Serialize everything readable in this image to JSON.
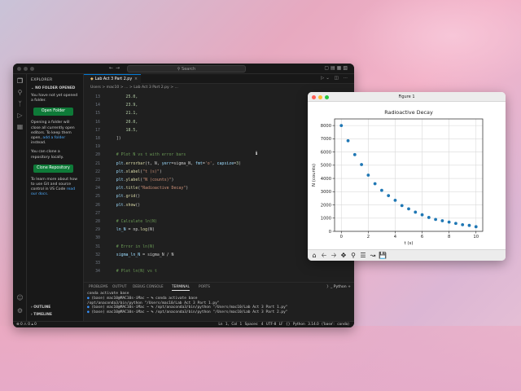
{
  "colors": {
    "green_button": "#0e7a38",
    "accent": "#0078d4",
    "link": "#4daafc",
    "plot_point": "#1f77b4"
  },
  "vscode": {
    "search_text": "Search",
    "tab_title": "Lab Act 3 Part 2.py",
    "breadcrumb": "Users > mac10 > ... > Lab Act 3 Part 2.py > ...",
    "explorer": {
      "title": "EXPLORER",
      "section": "NO FOLDER OPENED",
      "msg1": "You have not yet opened a folder.",
      "open_folder_label": "Open Folder",
      "msg2_pre": "Opening a folder will close all currently open editors. To keep them open,",
      "msg2_link": "add a folder",
      "msg2_post": "instead.",
      "msg3": "You can clone a repository locally.",
      "clone_label": "Clone Repository",
      "msg4_pre": "To learn more about how to use Git and source control in VS Code",
      "msg4_link": "read our docs.",
      "outline": "OUTLINE",
      "timeline": "TIMELINE"
    },
    "code_lines": [
      {
        "n": "13",
        "parts": [
          [
            "c-num",
            "        25.0,"
          ]
        ]
      },
      {
        "n": "14",
        "parts": [
          [
            "c-num",
            "        23.9,"
          ]
        ]
      },
      {
        "n": "15",
        "parts": [
          [
            "c-num",
            "        21.1,"
          ]
        ]
      },
      {
        "n": "16",
        "parts": [
          [
            "c-num",
            "        20.0,"
          ]
        ]
      },
      {
        "n": "17",
        "parts": [
          [
            "c-num",
            "        18.5,"
          ]
        ]
      },
      {
        "n": "18",
        "parts": [
          [
            "c-def",
            "    ])"
          ]
        ]
      },
      {
        "n": "19",
        "parts": []
      },
      {
        "n": "20",
        "parts": [
          [
            "c-com",
            "    # Plot N vs t with error bars"
          ]
        ]
      },
      {
        "n": "21",
        "parts": [
          [
            "c-var",
            "    plt"
          ],
          [
            "c-def",
            "."
          ],
          [
            "c-fn",
            "errorbar"
          ],
          [
            "c-def",
            "(t, N, "
          ],
          [
            "c-var",
            "yerr"
          ],
          [
            "c-def",
            "=sigma_N, "
          ],
          [
            "c-var",
            "fmt"
          ],
          [
            "c-def",
            "="
          ],
          [
            "c-str",
            "'o'"
          ],
          [
            "c-def",
            ", "
          ],
          [
            "c-var",
            "capsize"
          ],
          [
            "c-def",
            "="
          ],
          [
            "c-num",
            "3"
          ],
          [
            "c-def",
            ")"
          ]
        ]
      },
      {
        "n": "22",
        "parts": [
          [
            "c-var",
            "    plt"
          ],
          [
            "c-def",
            "."
          ],
          [
            "c-fn",
            "xlabel"
          ],
          [
            "c-def",
            "("
          ],
          [
            "c-str",
            "\"t (s)\""
          ],
          [
            "c-def",
            ")"
          ]
        ]
      },
      {
        "n": "23",
        "parts": [
          [
            "c-var",
            "    plt"
          ],
          [
            "c-def",
            "."
          ],
          [
            "c-fn",
            "ylabel"
          ],
          [
            "c-def",
            "("
          ],
          [
            "c-str",
            "\"N (counts)\""
          ],
          [
            "c-def",
            ")"
          ]
        ]
      },
      {
        "n": "24",
        "parts": [
          [
            "c-var",
            "    plt"
          ],
          [
            "c-def",
            "."
          ],
          [
            "c-fn",
            "title"
          ],
          [
            "c-def",
            "("
          ],
          [
            "c-str",
            "\"Radioactive Decay\""
          ],
          [
            "c-def",
            ")"
          ]
        ]
      },
      {
        "n": "25",
        "parts": [
          [
            "c-var",
            "    plt"
          ],
          [
            "c-def",
            "."
          ],
          [
            "c-fn",
            "grid"
          ],
          [
            "c-def",
            "()"
          ]
        ]
      },
      {
        "n": "26",
        "parts": [
          [
            "c-var",
            "    plt"
          ],
          [
            "c-def",
            "."
          ],
          [
            "c-fn",
            "show"
          ],
          [
            "c-def",
            "()"
          ]
        ]
      },
      {
        "n": "27",
        "parts": []
      },
      {
        "n": "28",
        "parts": [
          [
            "c-com",
            "    # Calculate ln(N)"
          ]
        ]
      },
      {
        "n": "29",
        "parts": [
          [
            "c-var",
            "    ln_N"
          ],
          [
            "c-def",
            " = np."
          ],
          [
            "c-fn",
            "log"
          ],
          [
            "c-def",
            "(N)"
          ]
        ]
      },
      {
        "n": "30",
        "parts": []
      },
      {
        "n": "31",
        "parts": [
          [
            "c-com",
            "    # Error in ln(N)"
          ]
        ]
      },
      {
        "n": "32",
        "parts": [
          [
            "c-var",
            "    sigma_ln_N"
          ],
          [
            "c-def",
            " = sigma_N / N"
          ]
        ]
      },
      {
        "n": "33",
        "parts": []
      },
      {
        "n": "34",
        "parts": [
          [
            "c-com",
            "    # Plot ln(N) vs t"
          ]
        ]
      }
    ],
    "panel": {
      "tabs": [
        "PROBLEMS",
        "OUTPUT",
        "DEBUG CONSOLE",
        "TERMINAL",
        "PORTS"
      ],
      "active_tab": "TERMINAL",
      "right_label": "Python",
      "terminal": [
        "conda activate base",
        "(base) mac10@MAC10s-iMac ~ % conda activate base",
        "/opt/anaconda3/bin/python \"/Users/mac10/Lab Act 3 Part 1.py\"",
        "(base) mac10@MAC10s-iMac ~ % /opt/anaconda3/bin/python \"/Users/mac10/Lab Act 3 Part 1.py\"",
        "(base) mac10@MAC10s-iMac ~ % /opt/anaconda3/bin/python \"/Users/mac10/Lab Act 3 Part 2.py\""
      ]
    },
    "status": {
      "left": "⊗ 0 ⚠ 0   ⫨ 0",
      "right": "Ln 1, Col 1   Spaces: 4   UTF-8   LF   {} Python   3.14.0 ('base': conda)"
    }
  },
  "figure": {
    "window_title": "Figure 1",
    "chart_data": {
      "type": "scatter",
      "title": "Radioactive Decay",
      "xlabel": "t (s)",
      "ylabel": "N (counts)",
      "xlim": [
        -0.5,
        10.5
      ],
      "ylim": [
        0,
        8500
      ],
      "xticks": [
        0,
        2,
        4,
        6,
        8,
        10
      ],
      "yticks": [
        0,
        1000,
        2000,
        3000,
        4000,
        5000,
        6000,
        7000,
        8000
      ],
      "grid": true,
      "series": [
        {
          "x": [
            0,
            0.5,
            1,
            1.5,
            2,
            2.5,
            3,
            3.5,
            4,
            4.5,
            5,
            5.5,
            6,
            6.5,
            7,
            7.5,
            8,
            8.5,
            9,
            9.5,
            10
          ],
          "values": [
            8000,
            6850,
            5800,
            5050,
            4250,
            3600,
            3100,
            2700,
            2350,
            1950,
            1700,
            1450,
            1250,
            1050,
            900,
            800,
            700,
            600,
            500,
            450,
            350
          ]
        }
      ]
    }
  }
}
